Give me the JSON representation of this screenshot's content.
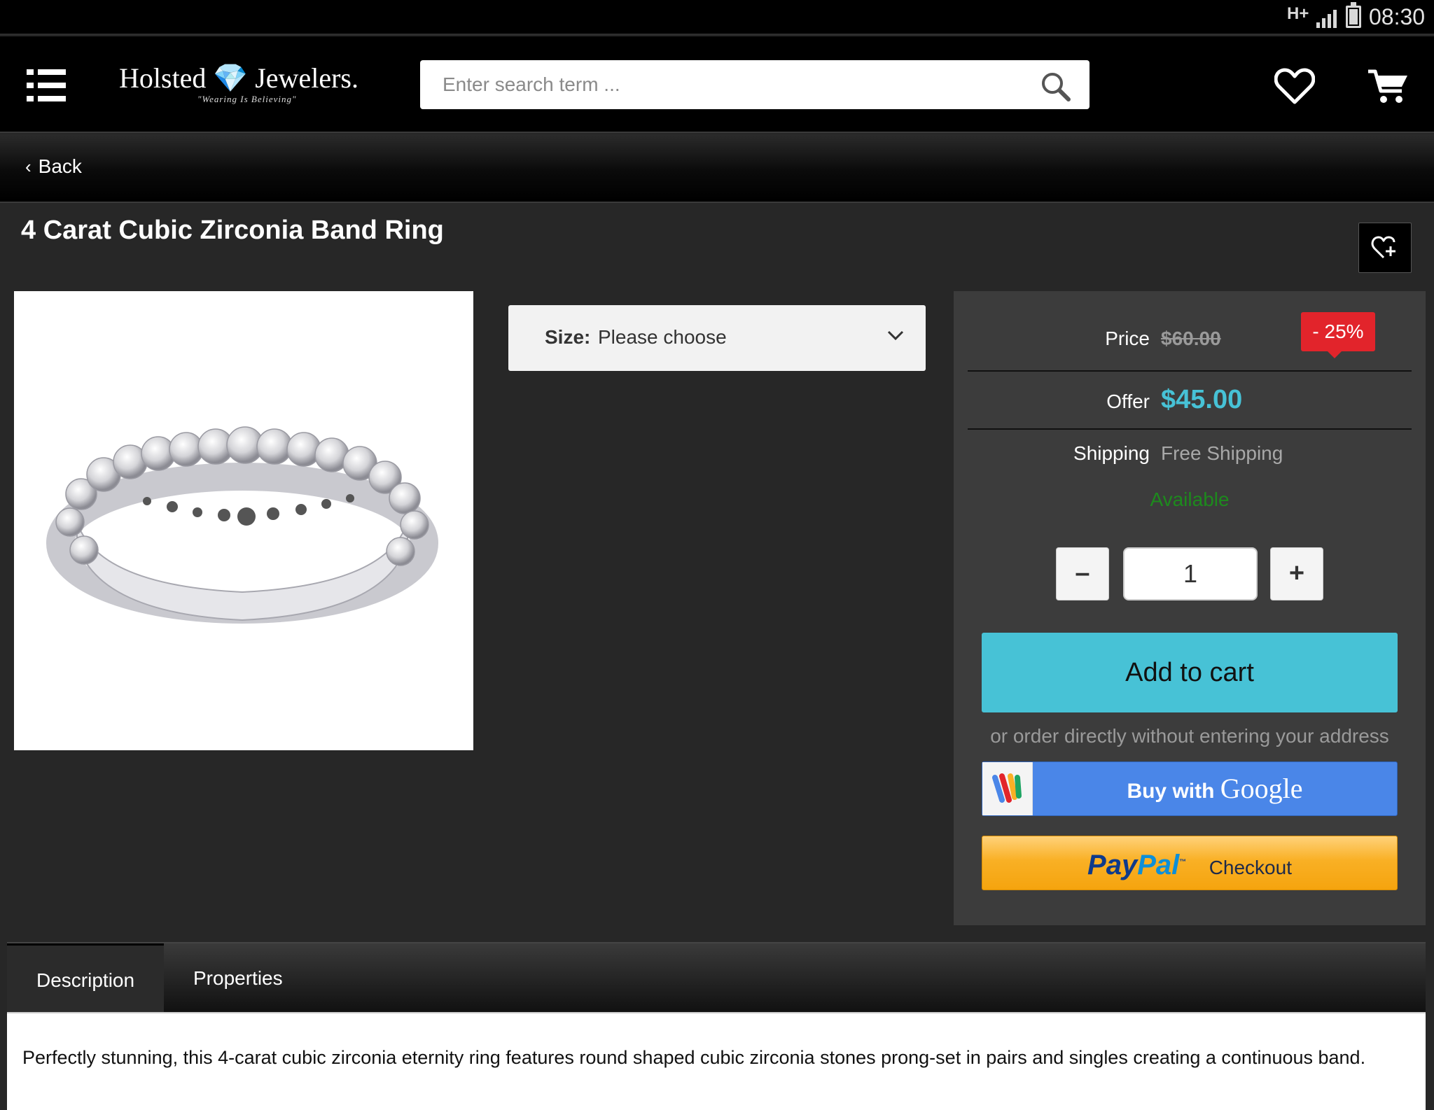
{
  "status_bar": {
    "network": "H+",
    "time": "08:30"
  },
  "header": {
    "logo": {
      "name": "Holsted 💎 Jewelers.",
      "tagline": "\"Wearing Is Believing\""
    },
    "search": {
      "placeholder": "Enter search term ...",
      "value": ""
    },
    "icons": [
      "menu-icon",
      "search-icon",
      "heart-icon",
      "cart-icon"
    ]
  },
  "nav": {
    "back_label": "Back"
  },
  "product": {
    "title": "4 Carat Cubic Zirconia Band Ring",
    "size_label": "Size:",
    "size_value": "Please choose",
    "price_label": "Price",
    "old_price": "$60.00",
    "discount": "- 25%",
    "offer_label": "Offer",
    "offer_price": "$45.00",
    "shipping_label": "Shipping",
    "shipping_value": "Free Shipping",
    "availability": "Available",
    "quantity": "1",
    "add_to_cart": "Add to cart",
    "or_text": "or order directly without entering your address",
    "google_button": {
      "prefix": "Buy with",
      "brand": "Google"
    },
    "paypal_button": {
      "brand_a": "Pay",
      "brand_b": "Pal",
      "tm": "™",
      "label": "Checkout"
    }
  },
  "tabs": [
    {
      "label": "Description",
      "active": true
    },
    {
      "label": "Properties",
      "active": false
    }
  ],
  "description": "Perfectly stunning, this 4-carat cubic zirconia eternity ring features round shaped cubic zirconia stones prong-set in pairs and singles creating a continuous band.",
  "colors": {
    "accent": "#47c2d6",
    "discount_red": "#e2242b",
    "available_green": "#1d8a1d",
    "google_blue": "#4a86e8",
    "paypal_orange": "#f9b025"
  }
}
